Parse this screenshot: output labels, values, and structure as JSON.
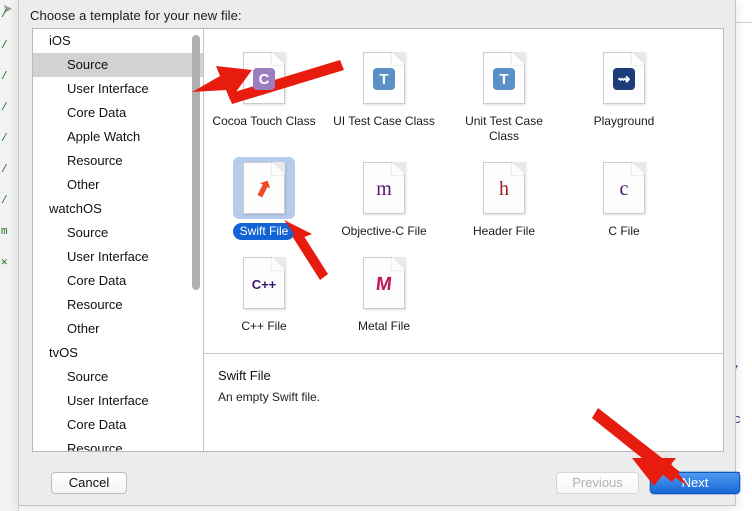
{
  "dialog": {
    "title": "Choose a template for your new file:"
  },
  "sidebar": {
    "items": [
      {
        "label": "iOS",
        "type": "group",
        "selected": false
      },
      {
        "label": "Source",
        "type": "child",
        "selected": true
      },
      {
        "label": "User Interface",
        "type": "child",
        "selected": false
      },
      {
        "label": "Core Data",
        "type": "child",
        "selected": false
      },
      {
        "label": "Apple Watch",
        "type": "child",
        "selected": false
      },
      {
        "label": "Resource",
        "type": "child",
        "selected": false
      },
      {
        "label": "Other",
        "type": "child",
        "selected": false
      },
      {
        "label": "watchOS",
        "type": "group",
        "selected": false
      },
      {
        "label": "Source",
        "type": "child",
        "selected": false
      },
      {
        "label": "User Interface",
        "type": "child",
        "selected": false
      },
      {
        "label": "Core Data",
        "type": "child",
        "selected": false
      },
      {
        "label": "Resource",
        "type": "child",
        "selected": false
      },
      {
        "label": "Other",
        "type": "child",
        "selected": false
      },
      {
        "label": "tvOS",
        "type": "group",
        "selected": false
      },
      {
        "label": "Source",
        "type": "child",
        "selected": false
      },
      {
        "label": "User Interface",
        "type": "child",
        "selected": false
      },
      {
        "label": "Core Data",
        "type": "child",
        "selected": false
      },
      {
        "label": "Resource",
        "type": "child",
        "selected": false
      }
    ]
  },
  "templates": [
    [
      {
        "label": "Cocoa Touch Class",
        "icon": "file-c-purple-icon",
        "glyph": "C",
        "style": "boxed",
        "color": "#ffffff",
        "bg": "#9b7ec0",
        "selected": false
      },
      {
        "label": "UI Test Case Class",
        "icon": "file-t-blue-icon",
        "glyph": "T",
        "style": "boxed",
        "color": "#ffffff",
        "bg": "#5a8fc8",
        "selected": false
      },
      {
        "label": "Unit Test Case Class",
        "icon": "file-t-blue-icon",
        "glyph": "T",
        "style": "boxed",
        "color": "#ffffff",
        "bg": "#5a8fc8",
        "selected": false
      },
      {
        "label": "Playground",
        "icon": "file-playground-icon",
        "glyph": "⇝",
        "style": "boxed",
        "color": "#ffffff",
        "bg": "#1b3c78",
        "selected": false
      }
    ],
    [
      {
        "label": "Swift File",
        "icon": "file-swift-icon",
        "glyph": "⬈",
        "style": "swift",
        "color": "#ee4c24",
        "bg": "transparent",
        "selected": true
      },
      {
        "label": "Objective-C File",
        "icon": "file-m-icon",
        "glyph": "m",
        "style": "serif",
        "color": "#5b1670",
        "bg": "transparent",
        "selected": false
      },
      {
        "label": "Header File",
        "icon": "file-h-icon",
        "glyph": "h",
        "style": "serif",
        "color": "#a01b2a",
        "bg": "transparent",
        "selected": false
      },
      {
        "label": "C File",
        "icon": "file-c-icon",
        "glyph": "c",
        "style": "serif",
        "color": "#4b1070",
        "bg": "transparent",
        "selected": false
      }
    ],
    [
      {
        "label": "C++ File",
        "icon": "file-cpp-icon",
        "glyph": "C++",
        "style": "tiny",
        "color": "#3b1470",
        "bg": "transparent",
        "selected": false
      },
      {
        "label": "Metal File",
        "icon": "file-metal-icon",
        "glyph": "M",
        "style": "metal",
        "color": "#c2185b",
        "bg": "transparent",
        "selected": false
      }
    ]
  ],
  "description": {
    "title": "Swift File",
    "text": "An empty Swift file."
  },
  "buttons": {
    "cancel": "Cancel",
    "previous": "Previous",
    "next": "Next"
  },
  "background_code": {
    "left_marks": "/\n/\n/\n/\n/\n/\n/\nm\n✕",
    "right_marks": "t,\nrc\ntr"
  },
  "colors": {
    "accent_blue": "#1264d4",
    "selection_gray": "#d2d2d2",
    "selected_tile": "#b5cdeb",
    "annotation_red": "#e81c0e",
    "dialog_bg": "#ececec"
  }
}
